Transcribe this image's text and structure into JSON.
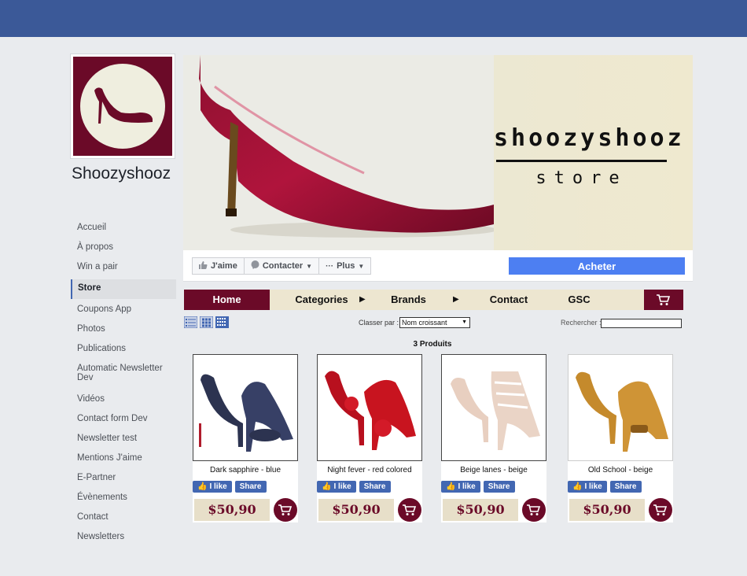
{
  "page": {
    "name": "Shoozyshooz"
  },
  "sidebar": {
    "items": [
      {
        "label": "Accueil",
        "active": false
      },
      {
        "label": "À propos",
        "active": false
      },
      {
        "label": "Win a pair",
        "active": false
      },
      {
        "label": "Store",
        "active": true
      },
      {
        "label": "Coupons App",
        "active": false
      },
      {
        "label": "Photos",
        "active": false
      },
      {
        "label": "Publications",
        "active": false
      },
      {
        "label": "Automatic Newsletter Dev",
        "active": false
      },
      {
        "label": "Vidéos",
        "active": false
      },
      {
        "label": "Contact form Dev",
        "active": false
      },
      {
        "label": "Newsletter test",
        "active": false
      },
      {
        "label": "Mentions J'aime",
        "active": false
      },
      {
        "label": "E-Partner",
        "active": false
      },
      {
        "label": "Évènements",
        "active": false
      },
      {
        "label": "Contact",
        "active": false
      },
      {
        "label": "Newsletters",
        "active": false
      }
    ]
  },
  "cover": {
    "title": "shoozyshooz",
    "subtitle": "store"
  },
  "actions": {
    "like": "J'aime",
    "contact": "Contacter",
    "more": "Plus",
    "buy": "Acheter"
  },
  "store_nav": {
    "home": "Home",
    "categories": "Categories",
    "brands": "Brands",
    "contact": "Contact",
    "gsc": "GSC"
  },
  "toolbar": {
    "sort_label": "Classer par :",
    "sort_value": "Nom croissant",
    "search_label": "Rechercher :",
    "search_value": "",
    "count_label": "3 Produits"
  },
  "products": [
    {
      "name": "Dark sapphire - blue",
      "price": "$50,90",
      "like": "I like",
      "share": "Share"
    },
    {
      "name": "Night fever - red colored",
      "price": "$50,90",
      "like": "I like",
      "share": "Share"
    },
    {
      "name": "Beige lanes - beige",
      "price": "$50,90",
      "like": "I like",
      "share": "Share"
    },
    {
      "name": "Old School - beige",
      "price": "$50,90",
      "like": "I like",
      "share": "Share"
    }
  ],
  "colors": {
    "fb_blue": "#3b5998",
    "brand_maroon": "#6b0a28",
    "cream": "#ede6d0",
    "buy_blue": "#4d7ff2"
  }
}
